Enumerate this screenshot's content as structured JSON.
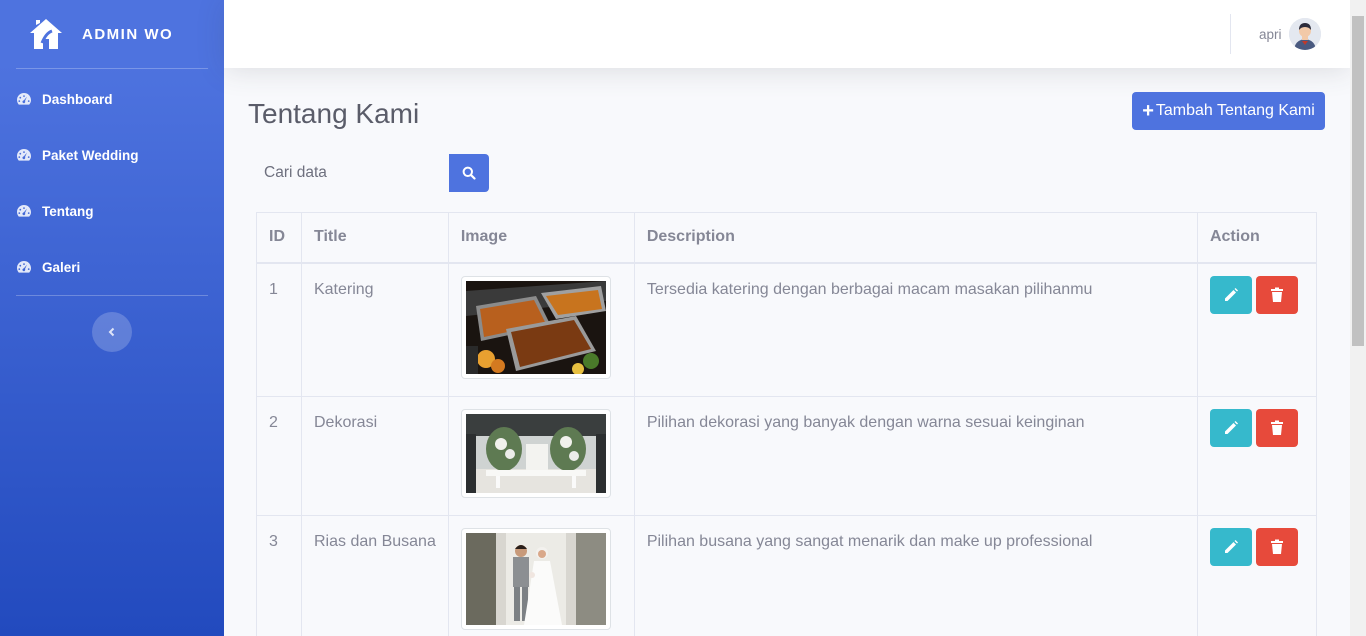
{
  "brand": {
    "text": "ADMIN WO",
    "icon": "house-icon"
  },
  "sidebar": {
    "items": [
      {
        "label": "Dashboard",
        "icon": "tachometer-icon"
      },
      {
        "label": "Paket Wedding",
        "icon": "tachometer-icon"
      },
      {
        "label": "Tentang",
        "icon": "tachometer-icon"
      },
      {
        "label": "Galeri",
        "icon": "tachometer-icon"
      }
    ],
    "toggle_icon": "chevron-left-icon"
  },
  "topbar": {
    "user_name": "apri",
    "avatar_icon": "user-avatar-icon"
  },
  "page": {
    "title": "Tentang Kami",
    "add_button_label": "Tambah Tentang Kami",
    "add_button_icon": "plus-icon",
    "search_placeholder": "Cari data",
    "search_icon": "search-icon"
  },
  "table": {
    "headers": [
      "ID",
      "Title",
      "Image",
      "Description",
      "Action"
    ],
    "rows": [
      {
        "id": "1",
        "title": "Katering",
        "image": "catering-photo",
        "description": "Tersedia katering dengan berbagai macam masakan pilihanmu"
      },
      {
        "id": "2",
        "title": "Dekorasi",
        "image": "decoration-photo",
        "description": "Pilihan dekorasi yang banyak dengan warna sesuai keinginan"
      },
      {
        "id": "3",
        "title": "Rias dan Busana",
        "image": "bridal-couple-photo",
        "description": "Pilihan busana yang sangat menarik dan make up professional"
      }
    ],
    "action_icons": [
      "pencil-icon",
      "trash-icon"
    ]
  },
  "colors": {
    "primary": "#4e73df",
    "info": "#36b9cc",
    "danger": "#e74a3b",
    "text": "#858796",
    "title": "#5a5c69"
  }
}
